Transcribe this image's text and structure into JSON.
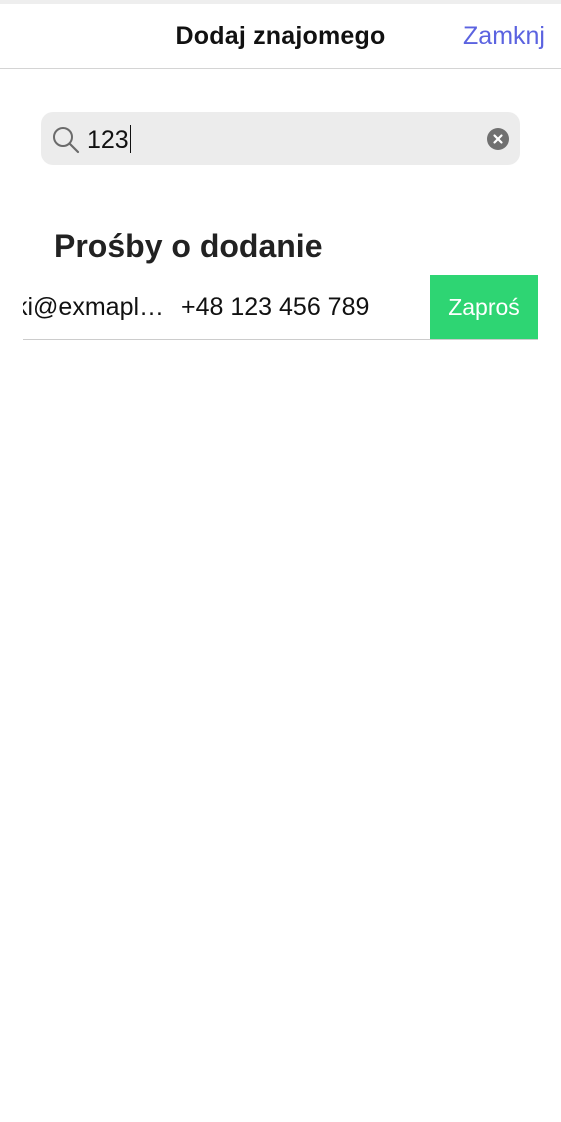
{
  "header": {
    "title": "Dodaj znajomego",
    "close_label": "Zamknj"
  },
  "search": {
    "value": "123",
    "icon": "search-icon",
    "clear_icon": "clear-icon"
  },
  "section": {
    "title": "Prośby o dodanie"
  },
  "results": [
    {
      "email": "ki@exmaple.com",
      "phone": "+48 123 456 789",
      "action_label": "Zaproś"
    }
  ],
  "colors": {
    "accent": "#5b63e0",
    "invite": "#2ed573",
    "search_bg": "#ececec"
  }
}
